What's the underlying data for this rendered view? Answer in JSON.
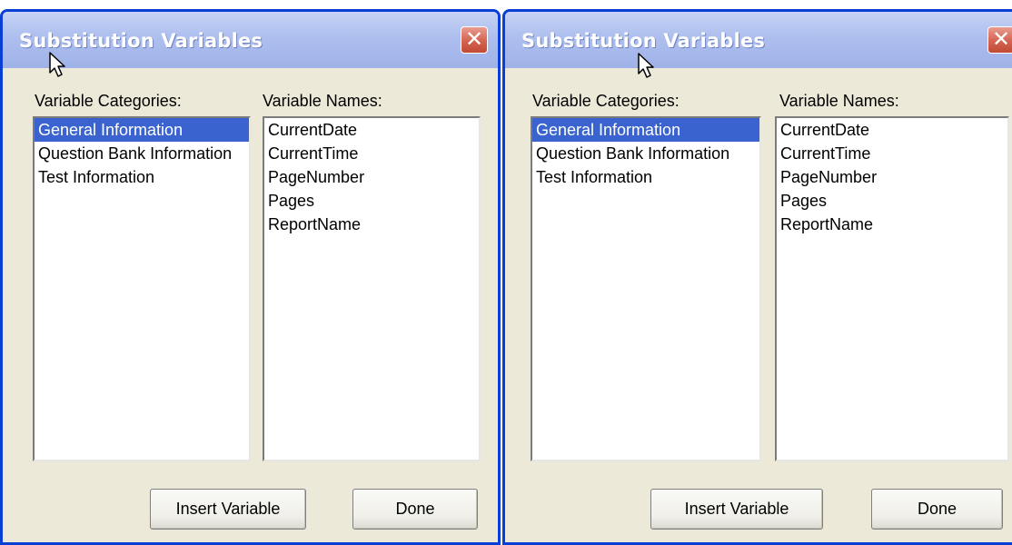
{
  "dialogs": [
    {
      "title": "Substitution Variables",
      "close_glyph": "✕",
      "categories_label": "Variable Categories:",
      "names_label": "Variable Names:",
      "categories": [
        "General Information",
        "Question Bank Information",
        "Test Information"
      ],
      "selected_category": "General Information",
      "variable_names": [
        "CurrentDate",
        "CurrentTime",
        "PageNumber",
        "Pages",
        "ReportName"
      ],
      "insert_button": "Insert Variable",
      "done_button": "Done"
    },
    {
      "title": "Substitution Variables",
      "close_glyph": "✕",
      "categories_label": "Variable Categories:",
      "names_label": "Variable Names:",
      "categories": [
        "General Information",
        "Question Bank Information",
        "Test Information"
      ],
      "selected_category": "General Information",
      "variable_names": [
        "CurrentDate",
        "CurrentTime",
        "PageNumber",
        "Pages",
        "ReportName"
      ],
      "insert_button": "Insert Variable",
      "done_button": "Done"
    }
  ],
  "icons": {
    "close": "close-icon",
    "cursor": "mouse-pointer-icon"
  },
  "colors": {
    "window_border": "#0a3fd6",
    "selection": "#3a63cf",
    "close_button": "#d4634f",
    "dialog_face": "#ece9d8"
  }
}
